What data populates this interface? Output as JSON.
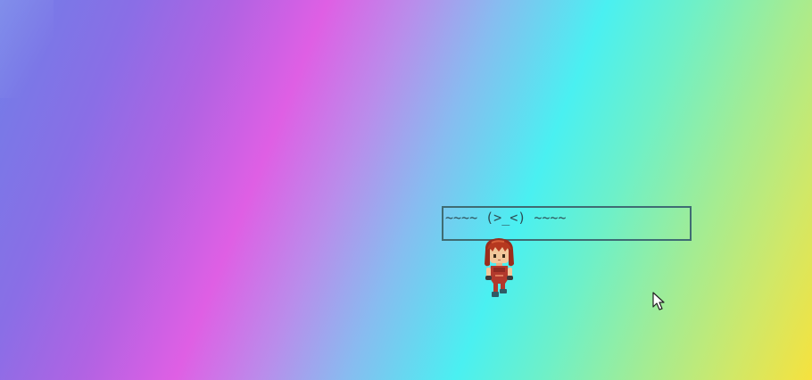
{
  "scene": {
    "background": "rainbow-gradient",
    "speech_bubble": {
      "text": "~~~~ (>_<) ~~~~",
      "border_color": "#3f6c73",
      "text_color": "#2d4d55"
    },
    "character": {
      "name": "red-haired-girl-sprite",
      "hair_color": "#a8321f",
      "dress_color": "#b2392c",
      "skin_color": "#f2c79a"
    },
    "cursor": {
      "icon": "pointer-arrow-icon"
    }
  }
}
